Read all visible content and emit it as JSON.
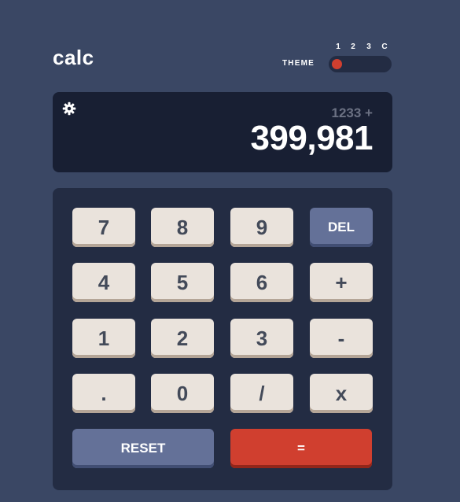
{
  "header": {
    "app_title": "calc",
    "theme_label": "THEME",
    "theme_options": [
      "1",
      "2",
      "3",
      "C"
    ],
    "selected_theme": "1"
  },
  "display": {
    "settings_icon": "gear-icon",
    "expression": "1233 +",
    "result": "399,981"
  },
  "keypad": {
    "keys": [
      "7",
      "8",
      "9",
      "DEL",
      "4",
      "5",
      "6",
      "+",
      "1",
      "2",
      "3",
      "-",
      ".",
      "0",
      "/",
      "x"
    ],
    "reset_label": "RESET",
    "equals_label": "="
  },
  "colors": {
    "background": "#3a4764",
    "display_bg": "#181f33",
    "keypad_bg": "#232c43",
    "key_bg": "#eae3dc",
    "key_text": "#434a59",
    "accent_blue": "#647198",
    "accent_red": "#d03f2f"
  }
}
